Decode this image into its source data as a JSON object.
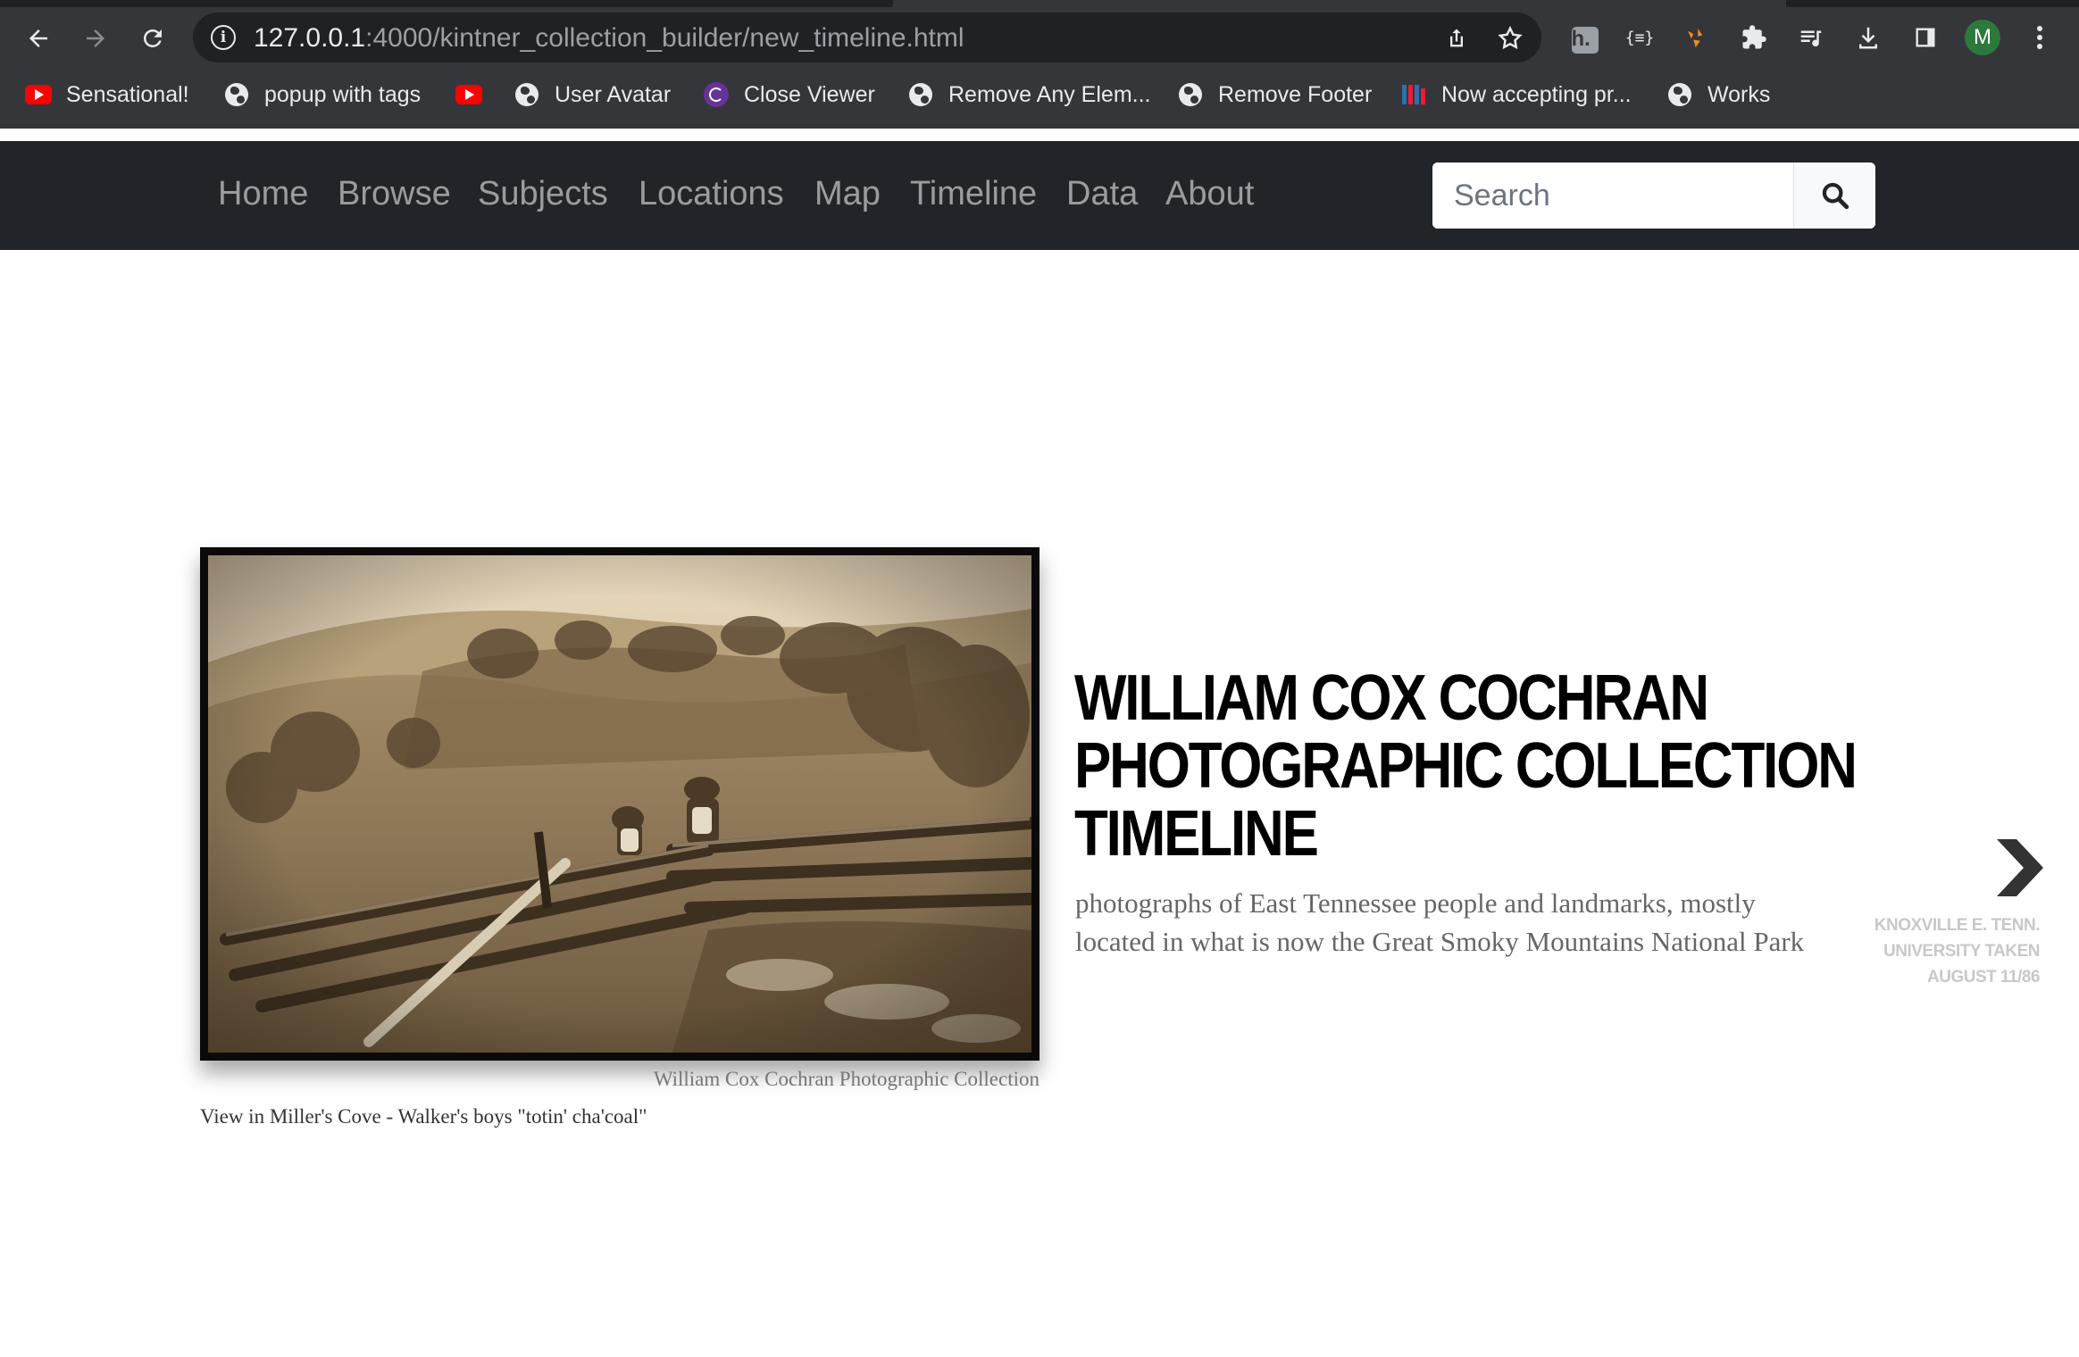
{
  "browser": {
    "url_host": "127.0.0.1",
    "url_path": ":4000/kintner_collection_builder/new_timeline.html",
    "profile_initial": "M",
    "bookmarks": [
      {
        "label": "Sensational!",
        "icon": "youtube-icon"
      },
      {
        "label": "popup with tags",
        "icon": "globe-icon"
      },
      {
        "label": "",
        "icon": "youtube-icon"
      },
      {
        "label": "User Avatar",
        "icon": "globe-icon"
      },
      {
        "label": "Close Viewer",
        "icon": "gatsby-icon"
      },
      {
        "label": "Remove Any Elem...",
        "icon": "globe-icon"
      },
      {
        "label": "Remove Footer",
        "icon": "globe-icon"
      },
      {
        "label": "Now accepting pr...",
        "icon": "iiif-icon"
      },
      {
        "label": "Works",
        "icon": "globe-icon"
      }
    ]
  },
  "navbar": {
    "links": [
      "Home",
      "Browse",
      "Subjects",
      "Locations",
      "Map",
      "Timeline",
      "Data",
      "About"
    ],
    "search_placeholder": "Search"
  },
  "slide": {
    "headline_lines": [
      "WILLIAM COX COCHRAN",
      "PHOTOGRAPHIC COLLECTION",
      "TIMELINE"
    ],
    "description": "photographs of East Tennessee people and landmarks, mostly located in what is now the Great Smoky Mountains National Park",
    "media_credit": "William Cox Cochran Photographic Collection",
    "media_caption": "View in Miller's Cove - Walker's boys \"totin' cha'coal\"",
    "next_slide_lines": [
      "KNOXVILLE E. TENN.",
      "UNIVERSITY TAKEN",
      "AUGUST 11/86"
    ]
  },
  "colors": {
    "browser_frame": "#35363a",
    "omnibox": "#202124",
    "navbar_bg": "#212529",
    "nav_link": "rgba(255,255,255,0.55)",
    "headline": "#000000",
    "description": "#666666",
    "sepia_photo": "#a08863"
  }
}
